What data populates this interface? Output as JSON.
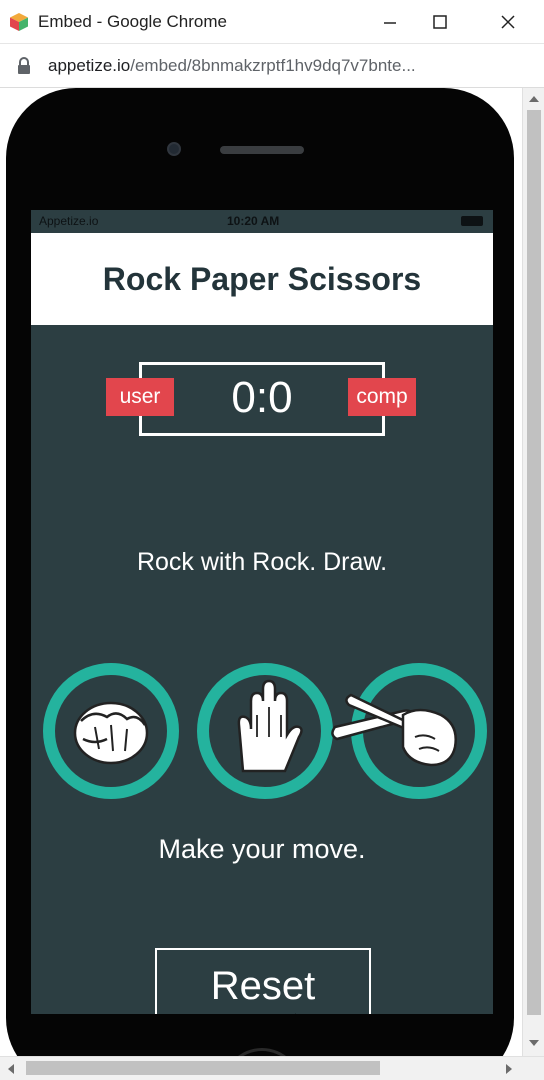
{
  "window": {
    "title": "Embed - Google Chrome",
    "controls": {
      "minimize": "minimize-icon",
      "maximize": "maximize-icon",
      "close": "close-icon"
    }
  },
  "address": {
    "url_host": "appetize.io",
    "url_path": "/embed/8bnmakzrptf1hv9dq7v7bnte..."
  },
  "phone": {
    "status_carrier": "Appetize.io",
    "status_time": "10:20 AM"
  },
  "app": {
    "title": "Rock Paper Scissors",
    "score": "0:0",
    "user_label": "user",
    "comp_label": "comp",
    "result": "Rock with Rock. Draw.",
    "choices": [
      {
        "name": "rock",
        "icon": "rock-hand-icon"
      },
      {
        "name": "paper",
        "icon": "paper-hand-icon"
      },
      {
        "name": "scissors",
        "icon": "scissors-hand-icon"
      }
    ],
    "prompt": "Make your move.",
    "reset_label": "Reset"
  },
  "colors": {
    "background": "#2c3e42",
    "accent": "#24b39e",
    "badge": "#e2464d",
    "header_text": "#23343a"
  }
}
